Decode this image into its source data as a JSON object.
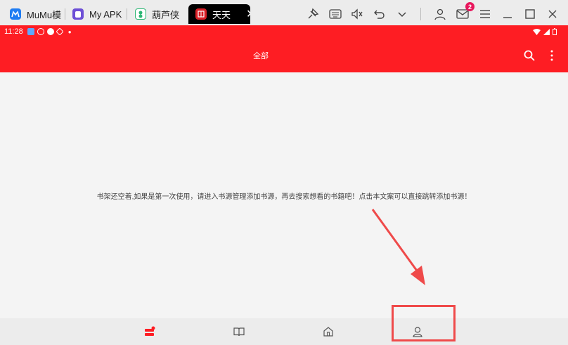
{
  "emulator": {
    "tabs": [
      {
        "label": "MuMu模",
        "icon": "mumu-icon"
      },
      {
        "label": "My APK",
        "icon": "my-apk-icon"
      },
      {
        "label": "葫芦侠",
        "icon": "huluxia-icon"
      },
      {
        "label": "天天",
        "icon": "tiantian-icon",
        "active": true
      }
    ],
    "notification_count": "2"
  },
  "statusbar": {
    "time": "11:28"
  },
  "appbar": {
    "title": "全部"
  },
  "main": {
    "empty_message": "书架还空着,如果是第一次使用，请进入书源管理添加书源，再去搜索想看的书籍吧！点击本文案可以直接跳转添加书源！"
  },
  "bottom_nav": {
    "items": [
      {
        "name": "bookshelf",
        "icon": "bookshelf-icon",
        "active": true
      },
      {
        "name": "discover",
        "icon": "book-open-icon"
      },
      {
        "name": "home",
        "icon": "home-icon"
      },
      {
        "name": "profile",
        "icon": "user-icon"
      }
    ]
  },
  "colors": {
    "accent": "#fe1d23",
    "annotation": "#ef4a4a"
  }
}
